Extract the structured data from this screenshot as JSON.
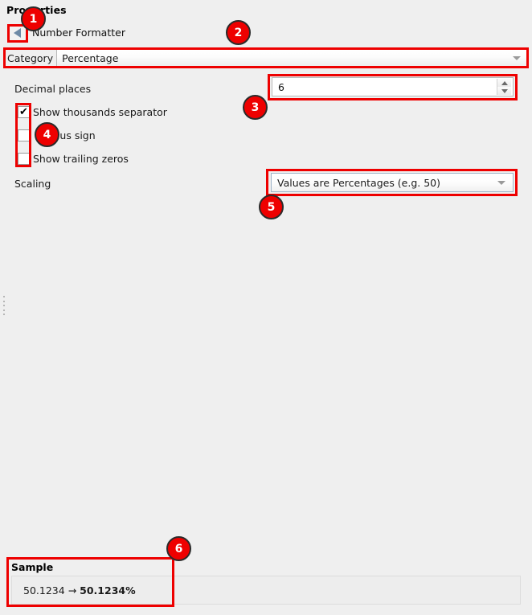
{
  "panel": {
    "title": "Properties",
    "subtitle": "Number Formatter",
    "back_icon": "back-arrow-icon"
  },
  "category": {
    "label": "Category",
    "value": "Percentage",
    "arrow_icon": "chevron-down-icon"
  },
  "decimal_places": {
    "label": "Decimal places",
    "value": "6",
    "up_icon": "spinner-up-icon",
    "down_icon": "spinner-down-icon"
  },
  "checkboxes": [
    {
      "label": "Show thousands separator",
      "checked": true,
      "mark": "✔"
    },
    {
      "label": "plus sign",
      "checked": false,
      "mark": ""
    },
    {
      "label": "Show trailing zeros",
      "checked": false,
      "mark": ""
    }
  ],
  "scaling": {
    "label": "Scaling",
    "value": "Values are Percentages (e.g. 50)",
    "arrow_icon": "chevron-down-icon"
  },
  "sample": {
    "title": "Sample",
    "input": "50.1234",
    "arrow": "→",
    "output": "50.1234%"
  },
  "annotations": {
    "markers": [
      "1",
      "2",
      "3",
      "4",
      "5",
      "6"
    ],
    "color": "#ee0000"
  }
}
